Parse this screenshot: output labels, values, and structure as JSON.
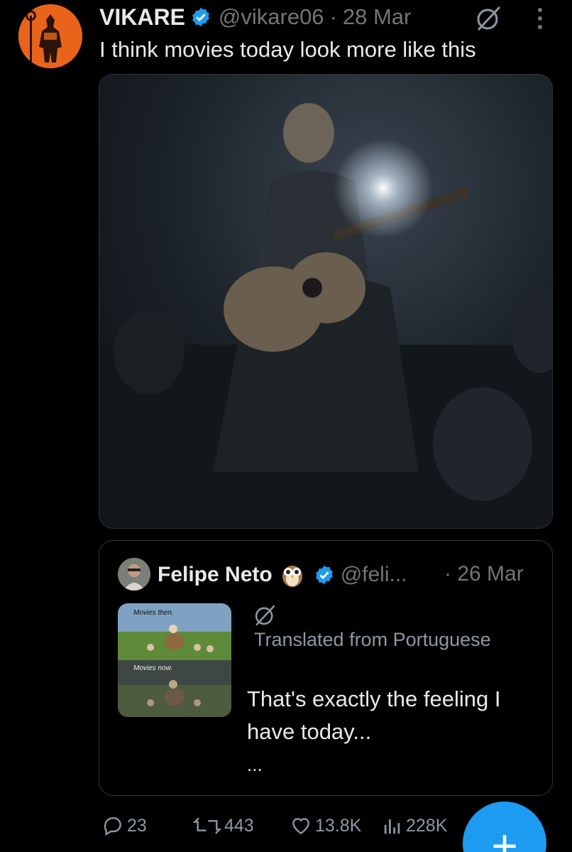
{
  "author": {
    "name": "VIKARE",
    "handle": "@vikare06",
    "separator": "·",
    "time": "28 Mar"
  },
  "tweet": {
    "text": "I think movies today look more like this"
  },
  "quote": {
    "name": "Felipe Neto",
    "handle": "@feli...",
    "time": "· 26 Mar",
    "thumb_caption_top": "Movies then.",
    "thumb_caption_bottom": "Movies now.",
    "translated_label": "Translated from Portuguese",
    "text": "That's exactly the feeling I have today...",
    "ellipsis": "..."
  },
  "actions": {
    "replies": "23",
    "retweets": "443",
    "likes": "13.8K",
    "views": "228K"
  },
  "fab": {
    "label": "+"
  },
  "colors": {
    "background": "#000000",
    "text": "#e7e9ea",
    "muted": "#71767b",
    "accent": "#1d9bf0",
    "avatar": "#e9641a"
  },
  "icons": [
    "verified-icon",
    "grok-icon",
    "more-icon",
    "owl-emoji-icon",
    "reply-icon",
    "retweet-icon",
    "like-icon",
    "views-icon",
    "compose-icon"
  ]
}
